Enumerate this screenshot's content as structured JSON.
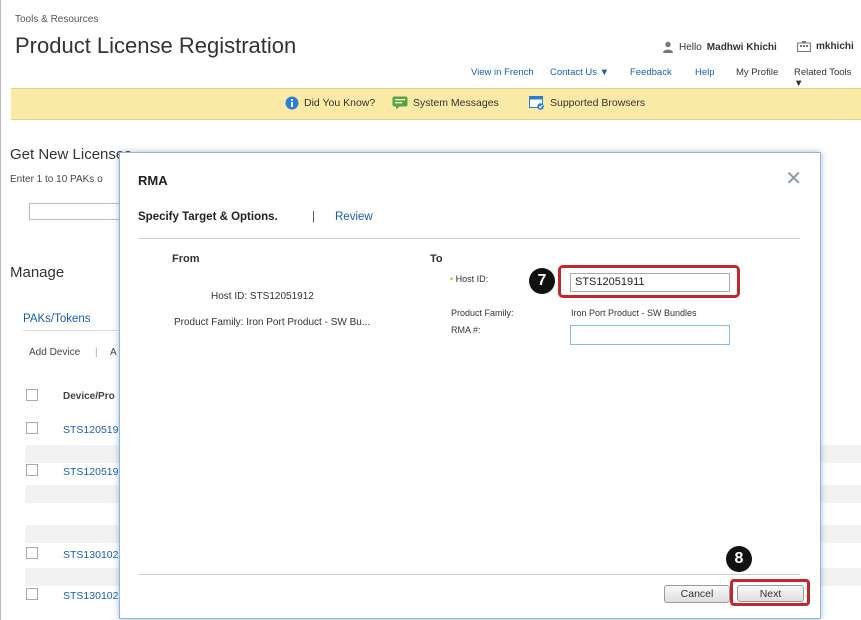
{
  "header": {
    "breadcrumb": "Tools & Resources",
    "title": "Product License Registration",
    "greeting_prefix": "Hello",
    "user_name": "Madhwi Khichi",
    "account": "mkhichi"
  },
  "nav": {
    "view_in_french": "View in French",
    "contact_us": "Contact Us ▼",
    "feedback": "Feedback",
    "help": "Help",
    "my_profile": "My Profile",
    "related_tools": "Related Tools ▼"
  },
  "banner": {
    "did_you_know": "Did You Know?",
    "system_messages": "System Messages",
    "supported_browsers": "Supported Browsers"
  },
  "background": {
    "get_new_licenses": "Get New Licenses",
    "enter_paks": "Enter 1 to 10 PAKs o",
    "manage": "Manage",
    "tab_paks": "PAKs/Tokens",
    "add_device": "Add Device",
    "add_device_sep": "|",
    "add_other": "A",
    "col_device": "Device/Pro",
    "rows": [
      "STS120519",
      "STS120519",
      "STS130102",
      "STS130102"
    ]
  },
  "modal": {
    "title": "RMA",
    "close": "✕",
    "step_active": "Specify Target & Options.",
    "step_separator": "|",
    "step_next": "Review",
    "from_label": "From",
    "to_label": "To",
    "from_host_id": "Host ID: STS12051912",
    "from_product_family": "Product Family: Iron Port Product - SW Bu...",
    "host_id_label": "Host ID:",
    "host_id_value": "STS12051911",
    "product_family_label": "Product Family:",
    "product_family_value": "Iron Port Product - SW Bundles",
    "rma_label": "RMA #:",
    "rma_value": "",
    "cancel_label": "Cancel",
    "next_label": "Next"
  },
  "annotations": {
    "step7": "7",
    "step8": "8"
  },
  "colors": {
    "link": "#1a5ea8",
    "highlight": "#c0282d",
    "banner": "#fbeaa6"
  }
}
